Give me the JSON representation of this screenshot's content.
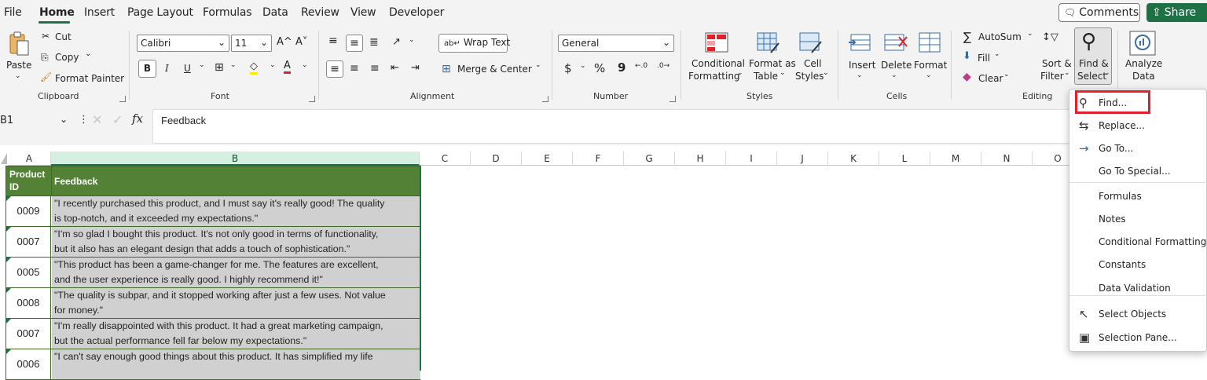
{
  "menu_tabs": [
    "File",
    "Home",
    "Insert",
    "Page Layout",
    "Formulas",
    "Data",
    "Review",
    "View",
    "Developer"
  ],
  "comments_label": "Comments",
  "share_label": "Share",
  "clipboard": {
    "paste": "Paste",
    "cut": "Cut",
    "copy": "Copy",
    "format_painter": "Format Painter",
    "group": "Clipboard"
  },
  "font": {
    "name": "Calibri",
    "size": "11",
    "bold": "B",
    "italic": "I",
    "underline": "U",
    "grow": "A^",
    "shrink": "A˅",
    "group": "Font"
  },
  "alignment": {
    "wrap_text": "Wrap Text",
    "merge_center": "Merge & Center",
    "group": "Alignment"
  },
  "number": {
    "format": "General",
    "currency": "$",
    "percent": "%",
    "comma": "9",
    "group": "Number"
  },
  "styles": {
    "conditional_1": "Conditional",
    "conditional_2": "Formatting",
    "format_as_1": "Format as",
    "format_as_2": "Table",
    "cell_styles_1": "Cell",
    "cell_styles_2": "Styles",
    "group": "Styles"
  },
  "cells": {
    "insert": "Insert",
    "delete": "Delete",
    "format": "Format",
    "group": "Cells"
  },
  "editing": {
    "autosum": "AutoSum",
    "fill": "Fill",
    "clear": "Clear",
    "sort_1": "Sort &",
    "sort_2": "Filter",
    "find_1": "Find &",
    "find_2": "Select",
    "group": "Editing"
  },
  "analysis": {
    "analyze_1": "Analyze",
    "analyze_2": "Data"
  },
  "formula_bar": {
    "name_box": "B1",
    "fx": "fx",
    "content": "Feedback"
  },
  "columns": [
    "A",
    "B",
    "C",
    "D",
    "E",
    "F",
    "G",
    "H",
    "I",
    "J",
    "K",
    "L",
    "M",
    "N",
    "O"
  ],
  "table": {
    "headers": [
      "Product ID",
      "Feedback"
    ],
    "rows": [
      {
        "id": "0009",
        "line1": "\"I recently purchased this product, and I must say it's really good! The quality",
        "line2": "is top-notch, and it exceeded my expectations.\""
      },
      {
        "id": "0007",
        "line1": "\"I'm so glad I bought this product. It's not only good in terms of functionality,",
        "line2": "but it also has an elegant design that adds a touch of sophistication.\""
      },
      {
        "id": "0005",
        "line1": "\"This product has been a game-changer for me. The features are excellent,",
        "line2": "and the user experience is really good. I highly recommend it!\""
      },
      {
        "id": "0008",
        "line1": "\"The quality is subpar, and it stopped working after just a few uses. Not value",
        "line2": "for money.\""
      },
      {
        "id": "0007",
        "line1": "\"I'm really disappointed with this product. It had a great marketing campaign,",
        "line2": "but the actual performance fell far below my expectations.\""
      },
      {
        "id": "0006",
        "line1": "\"I can't say enough good things about this product. It has simplified my life",
        "line2": ""
      }
    ]
  },
  "dropdown": {
    "items": [
      "Find...",
      "Replace...",
      "Go To...",
      "Go To Special...",
      "Formulas",
      "Notes",
      "Conditional Formatting",
      "Constants",
      "Data Validation",
      "Select Objects",
      "Selection Pane..."
    ]
  },
  "colors": {
    "header_green": "#538135",
    "accent": "#217346",
    "highlight": "#e0202a",
    "row_gray": "#d0d0d0"
  }
}
